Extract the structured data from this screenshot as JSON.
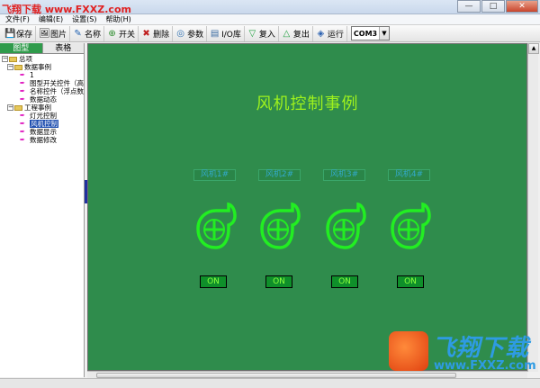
{
  "window": {
    "watermark_top": "飞翔下载 www.FXXZ.com",
    "menus": [
      "文件(F)",
      "编辑(E)",
      "设置(S)",
      "帮助(H)"
    ],
    "minimize": "—",
    "maximize": "□",
    "close": "✕"
  },
  "toolbar": {
    "buttons": [
      {
        "label": "保存",
        "icon": "save-icon",
        "glyph": "💾"
      },
      {
        "label": "图片",
        "icon": "picture-icon",
        "glyph": "🖼"
      },
      {
        "label": "名称",
        "icon": "pencil-icon",
        "glyph": "✎"
      },
      {
        "label": "开关",
        "icon": "switch-icon",
        "glyph": "⊕"
      },
      {
        "label": "删除",
        "icon": "delete-icon",
        "glyph": "✖"
      },
      {
        "label": "参数",
        "icon": "param-icon",
        "glyph": "◎"
      },
      {
        "label": "I/O库",
        "icon": "io-library-icon",
        "glyph": "▤"
      },
      {
        "label": "复入",
        "icon": "down-arrow-icon",
        "glyph": "▽"
      },
      {
        "label": "复出",
        "icon": "up-arrow-icon",
        "glyph": "△"
      },
      {
        "label": "运行",
        "icon": "run-icon",
        "glyph": "◈"
      }
    ],
    "port": "COM3"
  },
  "left_panel": {
    "tabs": [
      "图型",
      "表格"
    ],
    "tree": [
      {
        "label": "总项",
        "level": 0,
        "type": "folder",
        "exp": "−"
      },
      {
        "label": "数据事例",
        "level": 1,
        "type": "folder",
        "exp": "−"
      },
      {
        "label": "1",
        "level": 2,
        "type": "item"
      },
      {
        "label": "图型开关控件（高",
        "level": 2,
        "type": "item"
      },
      {
        "label": "名称控件（浮点数",
        "level": 2,
        "type": "item"
      },
      {
        "label": "数据动态",
        "level": 2,
        "type": "item"
      },
      {
        "label": "工程事例",
        "level": 1,
        "type": "folder",
        "exp": "−"
      },
      {
        "label": "灯光控制",
        "level": 2,
        "type": "item"
      },
      {
        "label": "风机控制",
        "level": 2,
        "type": "item",
        "selected": true
      },
      {
        "label": "数据显示",
        "level": 2,
        "type": "item"
      },
      {
        "label": "数据修改",
        "level": 2,
        "type": "item"
      }
    ]
  },
  "canvas": {
    "title": "风机控制事例",
    "fans": [
      {
        "label": "风机1#",
        "state": "ON"
      },
      {
        "label": "风机2#",
        "state": "ON"
      },
      {
        "label": "风机3#",
        "state": "ON"
      },
      {
        "label": "风机4#",
        "state": "ON"
      }
    ]
  },
  "watermark": {
    "title": "飞翔下载",
    "url": "www.FXXZ.com"
  },
  "colors": {
    "canvas_bg": "#2f8c4c",
    "title_text": "#9ef21d",
    "fan_green": "#22ee22",
    "on_button_bg": "#0f8f2a",
    "on_button_text": "#8cff3c",
    "tab_active": "#2f9b4b",
    "selection": "#1f4fb0"
  }
}
